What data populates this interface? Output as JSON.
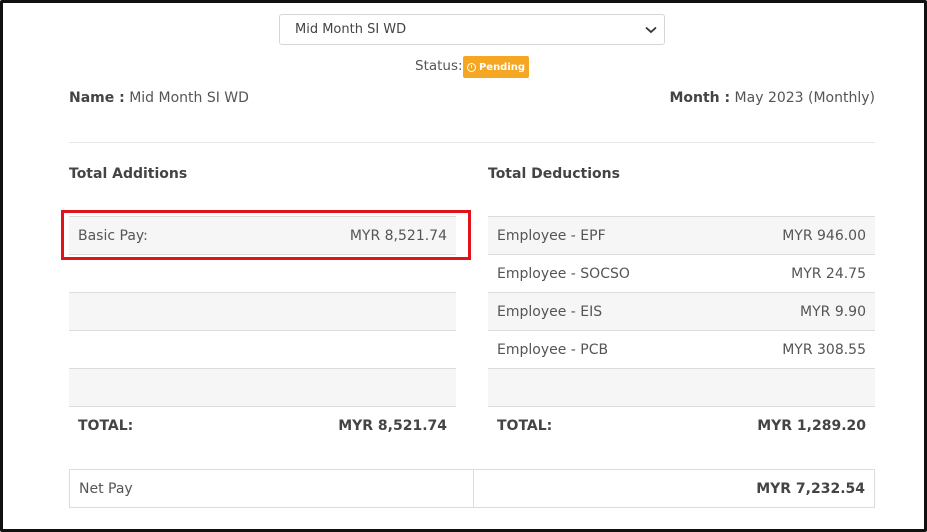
{
  "payslip_select": {
    "value": "Mid Month SI WD"
  },
  "status": {
    "label": "Status:",
    "badge": "Pending",
    "badge_color": "#f5a623"
  },
  "header": {
    "name_label": "Name :",
    "name_value": "Mid Month SI WD",
    "month_label": "Month :",
    "month_value": "May 2023 (Monthly)"
  },
  "additions": {
    "title": "Total Additions",
    "rows": [
      {
        "label": "Basic Pay:",
        "value": "MYR 8,521.74"
      },
      {
        "label": "",
        "value": ""
      },
      {
        "label": "",
        "value": ""
      },
      {
        "label": "",
        "value": ""
      },
      {
        "label": "",
        "value": ""
      }
    ],
    "total_label": "TOTAL:",
    "total_value": "MYR 8,521.74"
  },
  "deductions": {
    "title": "Total Deductions",
    "rows": [
      {
        "label": "Employee - EPF",
        "value": "MYR 946.00"
      },
      {
        "label": "Employee - SOCSO",
        "value": "MYR 24.75"
      },
      {
        "label": "Employee - EIS",
        "value": "MYR 9.90"
      },
      {
        "label": "Employee - PCB",
        "value": "MYR 308.55"
      },
      {
        "label": "",
        "value": ""
      }
    ],
    "total_label": "TOTAL:",
    "total_value": "MYR 1,289.20"
  },
  "net_pay": {
    "label": "Net Pay",
    "value": "MYR 7,232.54"
  },
  "highlight_color": "#e0121a"
}
